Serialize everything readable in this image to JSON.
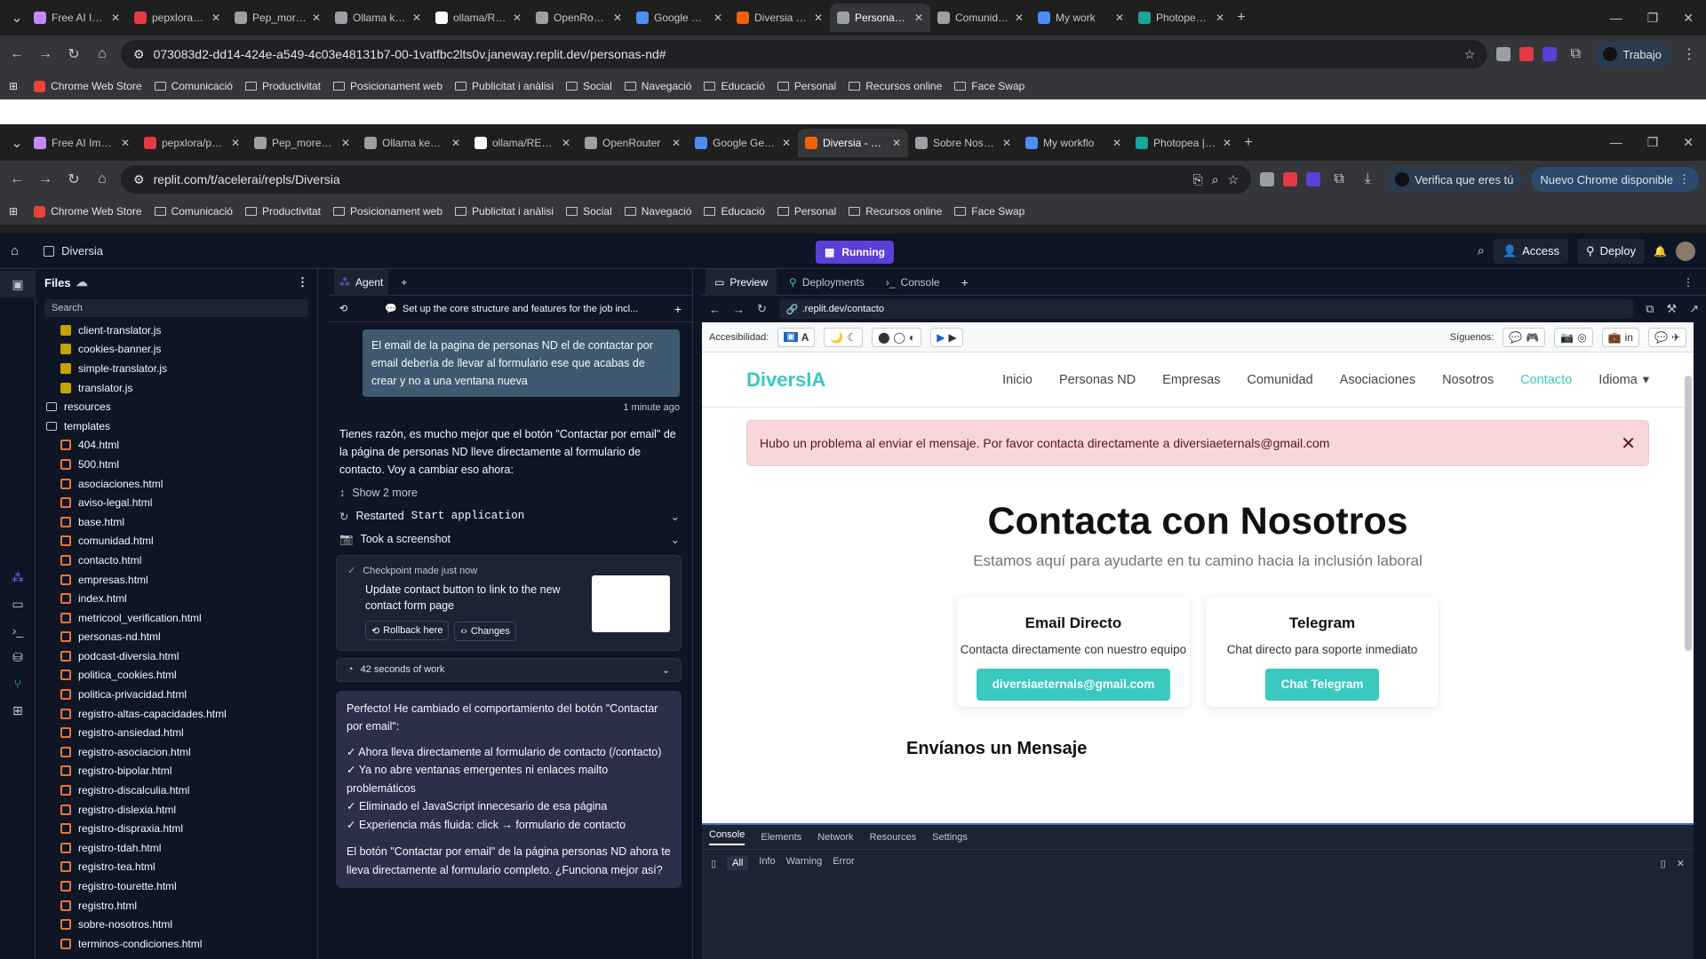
{
  "outer_browser": {
    "tabs": [
      {
        "label": "Free AI Image",
        "color": "#c58af9"
      },
      {
        "label": "pepxlora/pep",
        "color": "#e63946"
      },
      {
        "label": "Pep_moreno",
        "color": "#9aa0a6"
      },
      {
        "label": "Ollama keys",
        "color": "#9aa0a6"
      },
      {
        "label": "ollama/READ",
        "color": "#ffffff"
      },
      {
        "label": "OpenRouter",
        "color": "#9aa0a6"
      },
      {
        "label": "Google Gem",
        "color": "#4c8df6"
      },
      {
        "label": "Diversia - Re",
        "color": "#f26207"
      },
      {
        "label": "Personas Ne",
        "color": "#9aa0a6",
        "active": true
      },
      {
        "label": "Comunidad",
        "color": "#9aa0a6"
      },
      {
        "label": "My work",
        "color": "#4c8df6"
      },
      {
        "label": "Photopea | O",
        "color": "#18a497"
      }
    ],
    "url": "073083d2-dd14-424e-a549-4c03e48131b7-00-1vatfbc2lts0v.janeway.replit.dev/personas-nd#",
    "profile_label": "Trabajo"
  },
  "bookmarks": [
    "Chrome Web Store",
    "Comunicació",
    "Productivitat",
    "Posicionament web",
    "Publicitat i anàlisi",
    "Social",
    "Navegació",
    "Educació",
    "Personal",
    "Recursos online",
    "Face Swap"
  ],
  "inner_browser": {
    "tabs": [
      {
        "label": "Free AI Image",
        "color": "#c58af9"
      },
      {
        "label": "pepxlora/pept",
        "color": "#e63946"
      },
      {
        "label": "Pep_moreno/A",
        "color": "#9aa0a6"
      },
      {
        "label": "Ollama keys · S",
        "color": "#9aa0a6"
      },
      {
        "label": "ollama/READM",
        "color": "#ffffff"
      },
      {
        "label": "OpenRouter",
        "color": "#9aa0a6"
      },
      {
        "label": "Google Gemini",
        "color": "#4c8df6"
      },
      {
        "label": "Diversia - Repli",
        "color": "#f26207",
        "active": true
      },
      {
        "label": "Sobre Nosotro",
        "color": "#9aa0a6"
      },
      {
        "label": "My workflo",
        "color": "#4c8df6"
      },
      {
        "label": "Photopea | Onl",
        "color": "#18a497"
      }
    ],
    "url": "replit.com/t/acelerai/repls/Diversia",
    "verify_label": "Verifica que eres tú",
    "update_label": "Nuevo Chrome disponible"
  },
  "replit": {
    "project": "Diversia",
    "run_label": "Running",
    "access_label": "Access",
    "deploy_label": "Deploy",
    "files_title": "Files",
    "search_label": "Search",
    "files": [
      {
        "name": "client-translator.js",
        "type": "js"
      },
      {
        "name": "cookies-banner.js",
        "type": "js"
      },
      {
        "name": "simple-translator.js",
        "type": "js"
      },
      {
        "name": "translator.js",
        "type": "js"
      },
      {
        "name": "resources",
        "type": "dir-sub"
      },
      {
        "name": "templates",
        "type": "dir"
      },
      {
        "name": "404.html",
        "type": "html"
      },
      {
        "name": "500.html",
        "type": "html"
      },
      {
        "name": "asociaciones.html",
        "type": "html"
      },
      {
        "name": "aviso-legal.html",
        "type": "html"
      },
      {
        "name": "base.html",
        "type": "html"
      },
      {
        "name": "comunidad.html",
        "type": "html"
      },
      {
        "name": "contacto.html",
        "type": "html"
      },
      {
        "name": "empresas.html",
        "type": "html"
      },
      {
        "name": "index.html",
        "type": "html"
      },
      {
        "name": "metricool_verification.html",
        "type": "html"
      },
      {
        "name": "personas-nd.html",
        "type": "html"
      },
      {
        "name": "podcast-diversia.html",
        "type": "html"
      },
      {
        "name": "politica_cookies.html",
        "type": "html"
      },
      {
        "name": "politica-privacidad.html",
        "type": "html"
      },
      {
        "name": "registro-altas-capacidades.html",
        "type": "html"
      },
      {
        "name": "registro-ansiedad.html",
        "type": "html"
      },
      {
        "name": "registro-asociacion.html",
        "type": "html"
      },
      {
        "name": "registro-bipolar.html",
        "type": "html"
      },
      {
        "name": "registro-discalculia.html",
        "type": "html"
      },
      {
        "name": "registro-dislexia.html",
        "type": "html"
      },
      {
        "name": "registro-dispraxia.html",
        "type": "html"
      },
      {
        "name": "registro-tdah.html",
        "type": "html"
      },
      {
        "name": "registro-tea.html",
        "type": "html"
      },
      {
        "name": "registro-tourette.html",
        "type": "html"
      },
      {
        "name": "registro.html",
        "type": "html"
      },
      {
        "name": "sobre-nosotros.html",
        "type": "html"
      },
      {
        "name": "terminos-condiciones.html",
        "type": "html"
      }
    ],
    "agent": {
      "tab_label": "Agent",
      "thread_title": "Set up the core structure and features for the job incl...",
      "user_message": "El email de la pagina de personas ND el de contactar por email debería de llevar al formulario ese que acabas de crear y no a una ventana nueva",
      "time_ago": "1 minute ago",
      "reply": "Tienes razón, es mucho mejor que el botón \"Contactar por email\" de la página de personas ND lleve directamente al formulario de contacto. Voy a cambiar eso ahora:",
      "show_more": "Show 2 more",
      "restarted": "Restarted",
      "restarted_code": "Start application",
      "screenshot": "Took a screenshot",
      "checkpoint_title": "Checkpoint made just now",
      "checkpoint_desc": "Update contact button to link to the new contact form page",
      "rollback": "Rollback here",
      "changes": "Changes",
      "work_time": "42 seconds of work",
      "final_intro": "Perfecto! He cambiado el comportamiento del botón \"Contactar por email\":",
      "final_points": [
        "✓ Ahora lleva directamente al formulario de contacto (/contacto)",
        "✓ Ya no abre ventanas emergentes ni enlaces mailto problemáticos",
        "✓ Eliminado el JavaScript innecesario de esa página",
        "✓ Experiencia más fluida: click → formulario de contacto"
      ],
      "final_close": "El botón \"Contactar por email\" de la página personas ND ahora te lleva directamente al formulario completo. ¿Funciona mejor así?"
    },
    "preview": {
      "tabs": [
        "Preview",
        "Deployments",
        "Console"
      ],
      "url": ".replit.dev/contacto",
      "accessibility_label": "Accesibilidad:",
      "follow_label": "Síguenos:",
      "brand": "DiversIA",
      "menu": [
        "Inicio",
        "Personas ND",
        "Empresas",
        "Comunidad",
        "Asociaciones",
        "Nosotros",
        "Contacto",
        "Idioma"
      ],
      "alert": "Hubo un problema al enviar el mensaje. Por favor contacta directamente a diversiaeternals@gmail.com",
      "heading": "Contacta con Nosotros",
      "subheading": "Estamos aquí para ayudarte en tu camino hacia la inclusión laboral",
      "card_email_title": "Email Directo",
      "card_email_desc": "Contacta directamente con nuestro equipo",
      "card_email_btn": "diversiaeternals@gmail.com",
      "card_tg_title": "Telegram",
      "card_tg_desc": "Chat directo para soporte inmediato",
      "card_tg_btn": "Chat Telegram",
      "form_heading": "Envíanos un Mensaje",
      "accent": "#3ac9bf"
    },
    "devtools": {
      "tabs": [
        "Console",
        "Elements",
        "Network",
        "Resources",
        "Settings"
      ],
      "filters": [
        "All",
        "Info",
        "Warning",
        "Error"
      ]
    }
  }
}
